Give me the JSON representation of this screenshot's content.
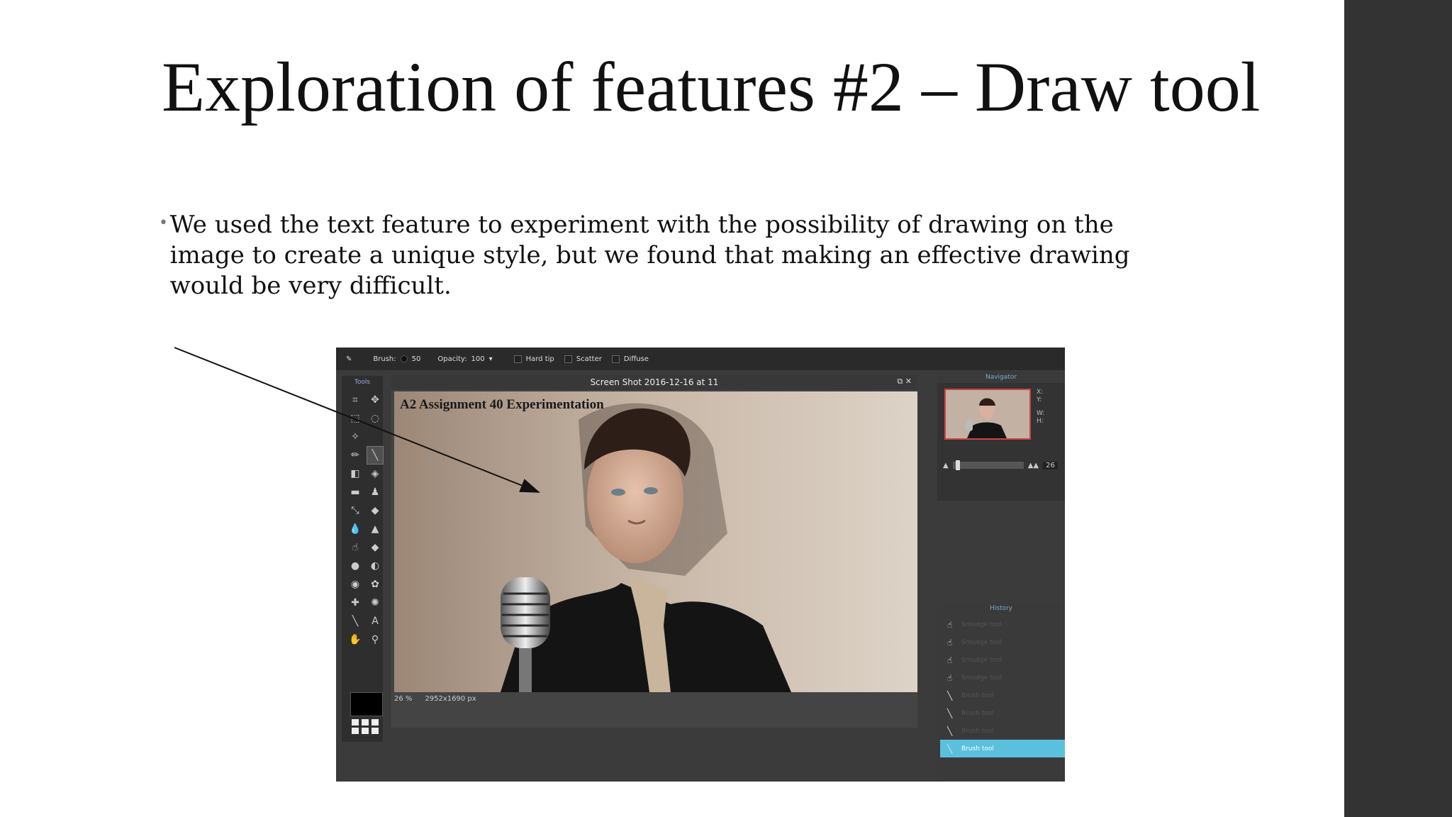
{
  "slide": {
    "title": "Exploration of features #2 – Draw tool",
    "bullet": "We used the text feature to experiment with the possibility of drawing on the image to create a unique style, but we found that making an effective drawing would be very difficult."
  },
  "editor": {
    "toolbar": {
      "brush_label": "Brush:",
      "brush_size": "50",
      "opacity_label": "Opacity:",
      "opacity_value": "100",
      "hard_tip": "Hard tip",
      "scatter": "Scatter",
      "diffuse": "Diffuse"
    },
    "tools_title": "Tools",
    "canvas_title": "Screen Shot 2016-12-16 at 11",
    "overlay_text": "A2 Assignment 40 Experimentation",
    "status": {
      "zoom": "26",
      "percent": "%",
      "dimensions": "2952x1690 px"
    },
    "navigator": {
      "title": "Navigator",
      "x": "X:",
      "y": "Y:",
      "w": "W:",
      "h": "H:",
      "zoom": "26"
    },
    "history": {
      "title": "History",
      "items": [
        "Smudge tool",
        "Smudge tool",
        "Smudge tool",
        "Smudge tool",
        "Brush tool",
        "Brush tool",
        "Brush tool",
        "Brush tool"
      ],
      "active": "Brush tool"
    }
  },
  "colors": {
    "accent": "#5bc0de",
    "band": "#333333"
  }
}
